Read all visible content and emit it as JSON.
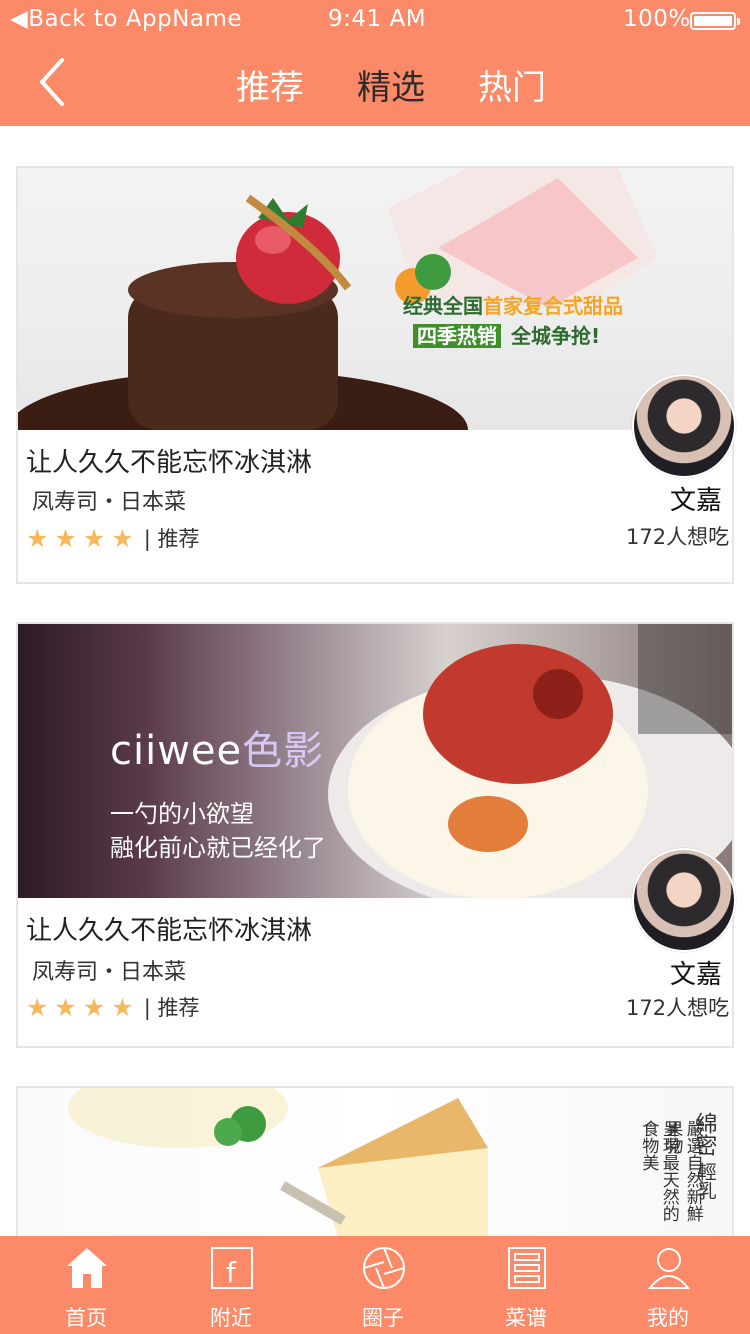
{
  "status_bar": {
    "back_app": "Back to AppName",
    "time": "9:41 AM",
    "battery": "100%"
  },
  "nav": {
    "tabs": [
      {
        "label": "推荐",
        "active": false
      },
      {
        "label": "精选",
        "active": true
      },
      {
        "label": "热门",
        "active": false
      }
    ]
  },
  "cards": [
    {
      "title": "让人久久不能忘怀冰淇淋",
      "subtitle": "凤寿司・日本菜",
      "stars": 4,
      "rating_tag": "| 推荐",
      "author": "文嘉",
      "want": "172人想吃",
      "image_text": {
        "line1_a": "经典全国",
        "line1_b": "首家复合式甜品",
        "line2_a": "四季热销",
        "line2_b": "全城争抢!"
      }
    },
    {
      "title": "让人久久不能忘怀冰淇淋",
      "subtitle": "凤寿司・日本菜",
      "stars": 4,
      "rating_tag": "| 推荐",
      "author": "文嘉",
      "want": "172人想吃",
      "image_text": {
        "brand_a": "ciiwee",
        "brand_b": "色影",
        "line1": "一勺的小欲望",
        "line2": "融化前心就已经化了"
      }
    },
    {
      "image_text": {
        "col1": "綿密",
        "col2": "輕乳",
        "col3": "嚴選自然新鮮果物",
        "col4": "呈現最天然的食物美"
      }
    }
  ],
  "tabbar": {
    "items": [
      {
        "label": "首页",
        "icon": "home-icon"
      },
      {
        "label": "附近",
        "icon": "nearby-icon"
      },
      {
        "label": "圈子",
        "icon": "circle-icon"
      },
      {
        "label": "菜谱",
        "icon": "recipe-icon"
      },
      {
        "label": "我的",
        "icon": "user-icon"
      }
    ]
  },
  "colors": {
    "primary": "#FC8A68",
    "star": "#F7B85C"
  }
}
